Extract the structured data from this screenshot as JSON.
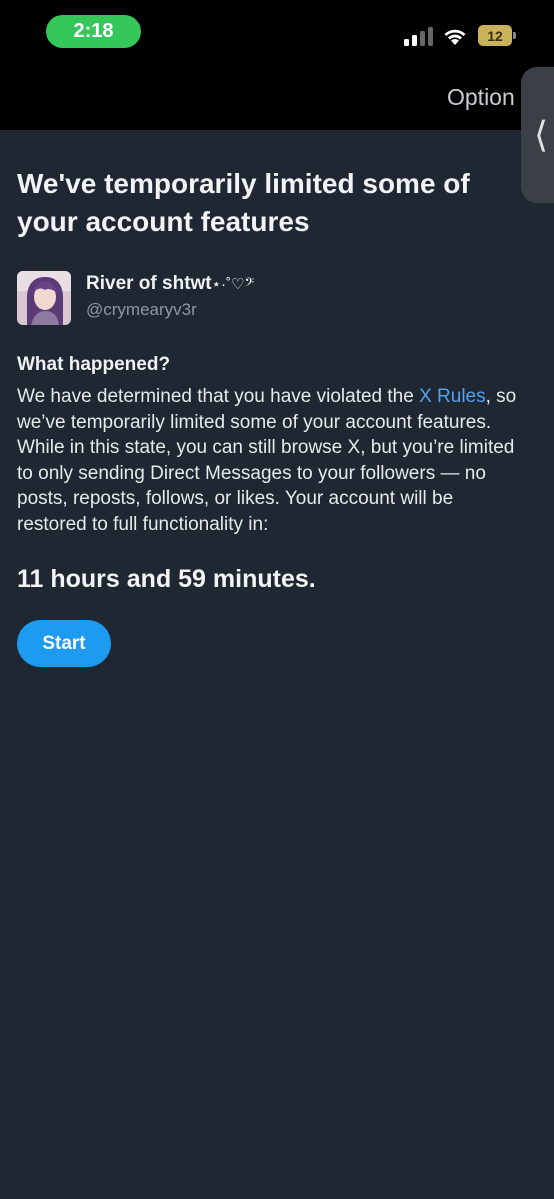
{
  "status_bar": {
    "time": "2:18",
    "battery": "12"
  },
  "header": {
    "options_label": "Option"
  },
  "main": {
    "title": "We've temporarily limited some of your account features",
    "profile": {
      "name": "River of shtwt",
      "name_decoration": "⋆·˚♡𝄢",
      "handle": "@crymearyv3r"
    },
    "section_heading": "What happened?",
    "body_before_link": "We have determined that you have violated the ",
    "link_text": "X Rules",
    "body_after_link": ", so we’ve temporarily limited some of your account features. While in this state, you can still browse X, but you’re limited to only sending Direct Messages to your followers — no posts, reposts, follows, or likes. Your account will be restored to full functionality in:",
    "countdown": "11 hours and 59 minutes.",
    "start_button": "Start"
  },
  "colors": {
    "background": "#1e2732",
    "accent": "#1d9bf0",
    "link": "#4fa3f0",
    "time_pill": "#35c759"
  }
}
